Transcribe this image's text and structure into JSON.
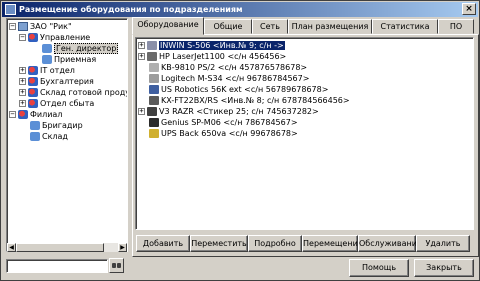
{
  "window": {
    "title": "Размещение оборудования по подразделениям"
  },
  "tree": {
    "nodes": [
      {
        "label": "ЗАО \"Рик\"",
        "expander": "−",
        "icon": "org-icon"
      },
      {
        "label": "Управление",
        "expander": "−",
        "icon": "department-icon"
      },
      {
        "label": "Ген. директор",
        "expander": "",
        "icon": "subdivision-icon",
        "selected": true
      },
      {
        "label": "Приемная",
        "expander": "",
        "icon": "subdivision-icon"
      },
      {
        "label": "IT отдел",
        "expander": "+",
        "icon": "department-icon"
      },
      {
        "label": "Бухгалтерия",
        "expander": "+",
        "icon": "department-icon"
      },
      {
        "label": "Склад готовой продукции",
        "expander": "+",
        "icon": "department-icon"
      },
      {
        "label": "Отдел сбыта",
        "expander": "+",
        "icon": "department-icon"
      },
      {
        "label": "Филиал",
        "expander": "−",
        "icon": "department-icon"
      },
      {
        "label": "Бригадир",
        "expander": "",
        "icon": "subdivision-icon"
      },
      {
        "label": "Склад",
        "expander": "",
        "icon": "subdivision-icon"
      }
    ]
  },
  "tabs": [
    "Оборудование",
    "Общие",
    "Сеть",
    "План размещения",
    "Статистика",
    "ПО"
  ],
  "equipment": [
    {
      "label": "INWIN S-506 <Инв.№ 9; с/н ->",
      "expander": "+",
      "icon": "computer-icon",
      "color": "#8a8fa8",
      "selected": true
    },
    {
      "label": "HP LaserJet1100 <с/н 456456>",
      "expander": "+",
      "icon": "printer-icon",
      "color": "#6a6a6a"
    },
    {
      "label": "KB-9810 PS/2 <с/н 457876578678>",
      "expander": "",
      "icon": "keyboard-icon",
      "color": "#b0b0b0"
    },
    {
      "label": "Logitech M-S34 <с/н 96786784567>",
      "expander": "",
      "icon": "mouse-icon",
      "color": "#9c9c9c"
    },
    {
      "label": "US Robotics 56K ext <с/н 56789678678>",
      "expander": "",
      "icon": "modem-icon",
      "color": "#3f5fa0"
    },
    {
      "label": "KX-FT22BX/RS <Инв.№ 8; с/н 678784566456>",
      "expander": "",
      "icon": "fax-icon",
      "color": "#5a5a5a"
    },
    {
      "label": "V3 RAZR <Стикер 25; с/н 745637282>",
      "expander": "+",
      "icon": "phone-icon",
      "color": "#404040"
    },
    {
      "label": "Genius SP-M06 <с/н 786784567>",
      "expander": "",
      "icon": "speakers-icon",
      "color": "#2b2b2b"
    },
    {
      "label": "UPS Back 650va <с/н 99678678>",
      "expander": "",
      "icon": "ups-icon",
      "color": "#d0b030"
    }
  ],
  "actions": {
    "add": "Добавить",
    "move": "Переместить",
    "details": "Подробно",
    "moves": "Перемещения",
    "service": "Обслуживание",
    "delete": "Удалить"
  },
  "footer": {
    "help": "Помощь",
    "close": "Закрыть",
    "search_value": ""
  }
}
